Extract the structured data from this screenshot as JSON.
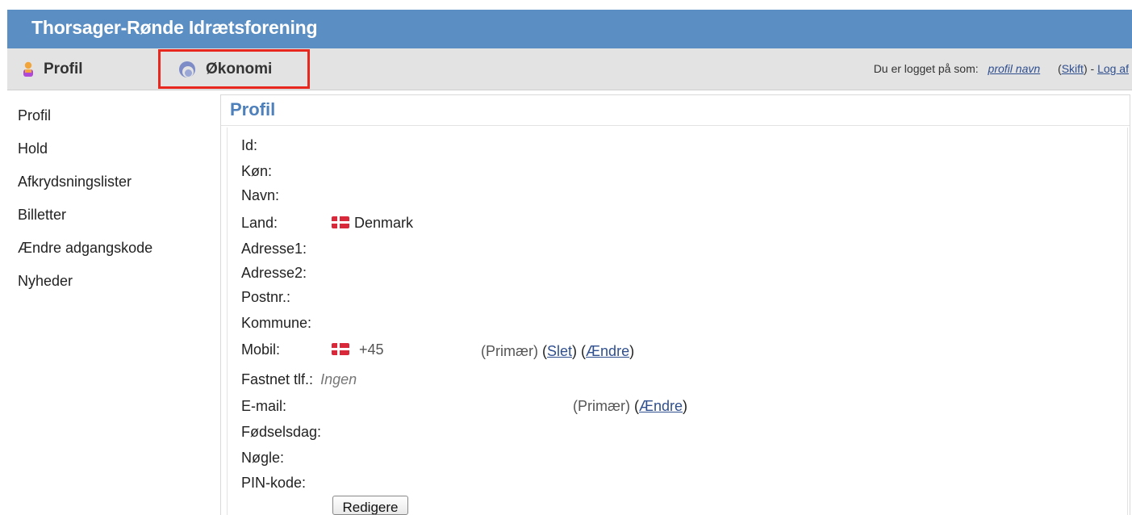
{
  "header": {
    "title": "Thorsager-Rønde Idrætsforening"
  },
  "menu": {
    "profil": {
      "label": "Profil",
      "icon": "user-icon"
    },
    "okonomi": {
      "label": "Økonomi",
      "icon": "economy-logo-icon",
      "highlight_color": "#e8281e"
    },
    "status": {
      "prefix": "Du er logget på som:",
      "profile_name": "profil navn",
      "switch_label": "Skift",
      "separator": " - ",
      "logout_label": "Log af"
    }
  },
  "sidebar": {
    "items": [
      {
        "label": "Profil"
      },
      {
        "label": "Hold"
      },
      {
        "label": "Afkrydsningslister"
      },
      {
        "label": "Billetter"
      },
      {
        "label": "Ændre adgangskode"
      },
      {
        "label": "Nyheder"
      }
    ]
  },
  "profile": {
    "title": "Profil",
    "fields": {
      "id": "Id:",
      "gender": "Køn:",
      "name": "Navn:",
      "country": "Land:",
      "address1": "Adresse1:",
      "address2": "Adresse2:",
      "postcode": "Postnr.:",
      "municipality": "Kommune:",
      "mobile": "Mobil:",
      "landline": "Fastnet tlf.:",
      "email": "E-mail:",
      "birthday": "Fødselsdag:",
      "key": "Nøgle:",
      "pin": "PIN-kode:"
    },
    "country_value": "Denmark",
    "mobile_prefix": "+45",
    "primary_label": "(Primær)",
    "delete_label": "Slet",
    "change_label": "Ændre",
    "landline_value": "Ingen",
    "edit_button": "Redigere"
  },
  "colors": {
    "header_bg": "#5b8ec2",
    "accent": "#4e80bb",
    "link": "#2f4f8f"
  }
}
